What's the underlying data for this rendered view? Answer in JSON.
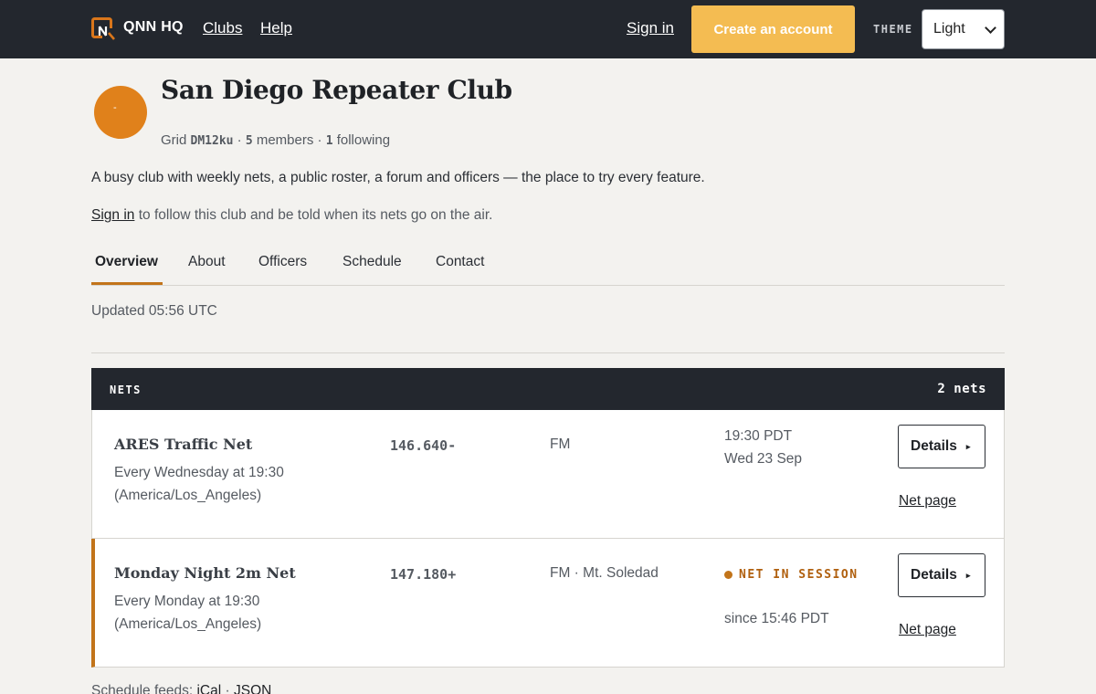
{
  "nav": {
    "brand": "QNN HQ",
    "links": [
      "Clubs",
      "Help"
    ],
    "sign_in": "Sign in",
    "create_account": "Create an account",
    "theme_label": "THEME",
    "theme_value": "Light"
  },
  "club": {
    "avatar_glyph": "-",
    "name": "San Diego Repeater Club",
    "grid_label": "Grid",
    "grid": "DM12ku",
    "members_count": "5",
    "members_label": "members",
    "following_count": "1",
    "following_label": "following",
    "description": "A busy club with weekly nets, a public roster, a forum and officers — the place to try every feature.",
    "signin_link": "Sign in",
    "signin_rest": " to follow this club and be told when its nets go on the air."
  },
  "tabs": [
    "Overview",
    "About",
    "Officers",
    "Schedule",
    "Contact"
  ],
  "updated": "Updated 05:56 UTC",
  "nets": {
    "header_label": "NETS",
    "count": "2 nets",
    "rows": [
      {
        "name": "ARES Traffic Net",
        "schedule": "Every Wednesday at 19:30 (America/Los_Angeles)",
        "frequency": "146.640-",
        "mode": "FM",
        "time": "19:30 PDT",
        "date": "Wed 23 Sep",
        "details": "Details",
        "net_page": "Net page"
      },
      {
        "name": "Monday Night 2m Net",
        "schedule": "Every Monday at 19:30 (America/Los_Angeles)",
        "frequency": "147.180+",
        "mode": "FM · Mt. Soledad",
        "status": "NET IN SESSION",
        "since": "since 15:46 PDT",
        "details": "Details",
        "net_page": "Net page"
      }
    ]
  },
  "feeds": {
    "label": "Schedule feeds:",
    "links": [
      "iCal",
      "JSON"
    ]
  },
  "colors": {
    "nav_bg": "#23272e",
    "accent": "#f4bc52",
    "live": "#c2741a",
    "avatar": "#e0811b"
  }
}
